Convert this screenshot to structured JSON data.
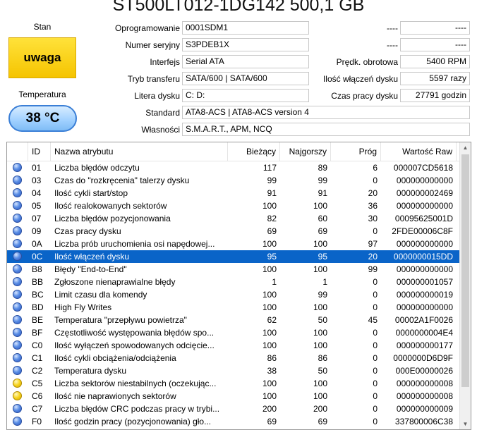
{
  "disk": {
    "title": "ST500LT012-1DG142 500,1 GB",
    "stan_label": "Stan",
    "status": "uwaga",
    "temperature_label": "Temperatura",
    "temperature": "38 °C"
  },
  "info": {
    "firmware_label": "Oprogramowanie",
    "firmware": "0001SDM1",
    "serial_label": "Numer seryjny",
    "serial": "S3PDEB1X",
    "interface_label": "Interfejs",
    "interface": "Serial ATA",
    "transfer_label": "Tryb transferu",
    "transfer": "SATA/600 | SATA/600",
    "letter_label": "Litera dysku",
    "letter": "C: D:",
    "standard_label": "Standard",
    "standard": "ATA8-ACS | ATA8-ACS version 4",
    "features_label": "Własności",
    "features": "S.M.A.R.T., APM, NCQ",
    "right1_label": "----",
    "right1": "----",
    "right2_label": "----",
    "right2": "----",
    "rpm_label": "Prędk. obrotowa",
    "rpm": "5400 RPM",
    "power_count_label": "Ilość włączeń dysku",
    "power_count": "5597 razy",
    "power_hours_label": "Czas pracy dysku",
    "power_hours": "27791 godzin"
  },
  "table": {
    "headers": {
      "id": "ID",
      "name": "Nazwa atrybutu",
      "current": "Bieżący",
      "worst": "Najgorszy",
      "threshold": "Próg",
      "raw": "Wartość Raw"
    },
    "rows": [
      {
        "status": "blue",
        "id": "01",
        "name": "Liczba błędów odczytu",
        "current": "117",
        "worst": "89",
        "threshold": "6",
        "raw": "000007CD5618"
      },
      {
        "status": "blue",
        "id": "03",
        "name": "Czas do \"rozkręcenia\" talerzy dysku",
        "current": "99",
        "worst": "99",
        "threshold": "0",
        "raw": "000000000000"
      },
      {
        "status": "blue",
        "id": "04",
        "name": "Ilość cykli start/stop",
        "current": "91",
        "worst": "91",
        "threshold": "20",
        "raw": "000000002469"
      },
      {
        "status": "blue",
        "id": "05",
        "name": "Ilość realokowanych sektorów",
        "current": "100",
        "worst": "100",
        "threshold": "36",
        "raw": "000000000000"
      },
      {
        "status": "blue",
        "id": "07",
        "name": "Liczba błędów pozycjonowania",
        "current": "82",
        "worst": "60",
        "threshold": "30",
        "raw": "00095625001D"
      },
      {
        "status": "blue",
        "id": "09",
        "name": "Czas pracy dysku",
        "current": "69",
        "worst": "69",
        "threshold": "0",
        "raw": "2FDE00006C8F"
      },
      {
        "status": "blue",
        "id": "0A",
        "name": "Liczba prób uruchomienia osi napędowej...",
        "current": "100",
        "worst": "100",
        "threshold": "97",
        "raw": "000000000000"
      },
      {
        "status": "blue",
        "id": "0C",
        "name": "Ilość włączeń dysku",
        "current": "95",
        "worst": "95",
        "threshold": "20",
        "raw": "0000000015DD",
        "selected": true
      },
      {
        "status": "blue",
        "id": "B8",
        "name": "Błędy \"End-to-End\"",
        "current": "100",
        "worst": "100",
        "threshold": "99",
        "raw": "000000000000"
      },
      {
        "status": "blue",
        "id": "BB",
        "name": "Zgłoszone nienaprawialne błędy",
        "current": "1",
        "worst": "1",
        "threshold": "0",
        "raw": "000000001057"
      },
      {
        "status": "blue",
        "id": "BC",
        "name": "Limit czasu dla komendy",
        "current": "100",
        "worst": "99",
        "threshold": "0",
        "raw": "000000000019"
      },
      {
        "status": "blue",
        "id": "BD",
        "name": "High Fly Writes",
        "current": "100",
        "worst": "100",
        "threshold": "0",
        "raw": "000000000000"
      },
      {
        "status": "blue",
        "id": "BE",
        "name": "Temperatura \"przepływu powietrza\"",
        "current": "62",
        "worst": "50",
        "threshold": "45",
        "raw": "00002A1F0026"
      },
      {
        "status": "blue",
        "id": "BF",
        "name": "Częstotliwość występowania błędów spo...",
        "current": "100",
        "worst": "100",
        "threshold": "0",
        "raw": "0000000004E4"
      },
      {
        "status": "blue",
        "id": "C0",
        "name": "Ilość wyłączeń spowodowanych odcięcie...",
        "current": "100",
        "worst": "100",
        "threshold": "0",
        "raw": "000000000177"
      },
      {
        "status": "blue",
        "id": "C1",
        "name": "Ilość cykli obciążenia/odciążenia",
        "current": "86",
        "worst": "86",
        "threshold": "0",
        "raw": "0000000D6D9F"
      },
      {
        "status": "blue",
        "id": "C2",
        "name": "Temperatura dysku",
        "current": "38",
        "worst": "50",
        "threshold": "0",
        "raw": "000E00000026"
      },
      {
        "status": "yellow",
        "id": "C5",
        "name": "Liczba sektorów niestabilnych (oczekując...",
        "current": "100",
        "worst": "100",
        "threshold": "0",
        "raw": "000000000008"
      },
      {
        "status": "yellow",
        "id": "C6",
        "name": "Ilość nie naprawionych sektorów",
        "current": "100",
        "worst": "100",
        "threshold": "0",
        "raw": "000000000008"
      },
      {
        "status": "blue",
        "id": "C7",
        "name": "Liczba błędów CRC podczas pracy w trybi...",
        "current": "200",
        "worst": "200",
        "threshold": "0",
        "raw": "000000000009"
      },
      {
        "status": "blue",
        "id": "F0",
        "name": "Ilość godzin pracy (pozycjonowania) gło...",
        "current": "69",
        "worst": "69",
        "threshold": "0",
        "raw": "337800006C38"
      }
    ]
  },
  "colors": {
    "status_warning": "#f5c400",
    "selection": "#0a64c8",
    "good": "#2a55c0",
    "caution": "#f7d31c"
  },
  "icons": {
    "good": "blue-circle-icon",
    "caution": "yellow-circle-icon"
  }
}
